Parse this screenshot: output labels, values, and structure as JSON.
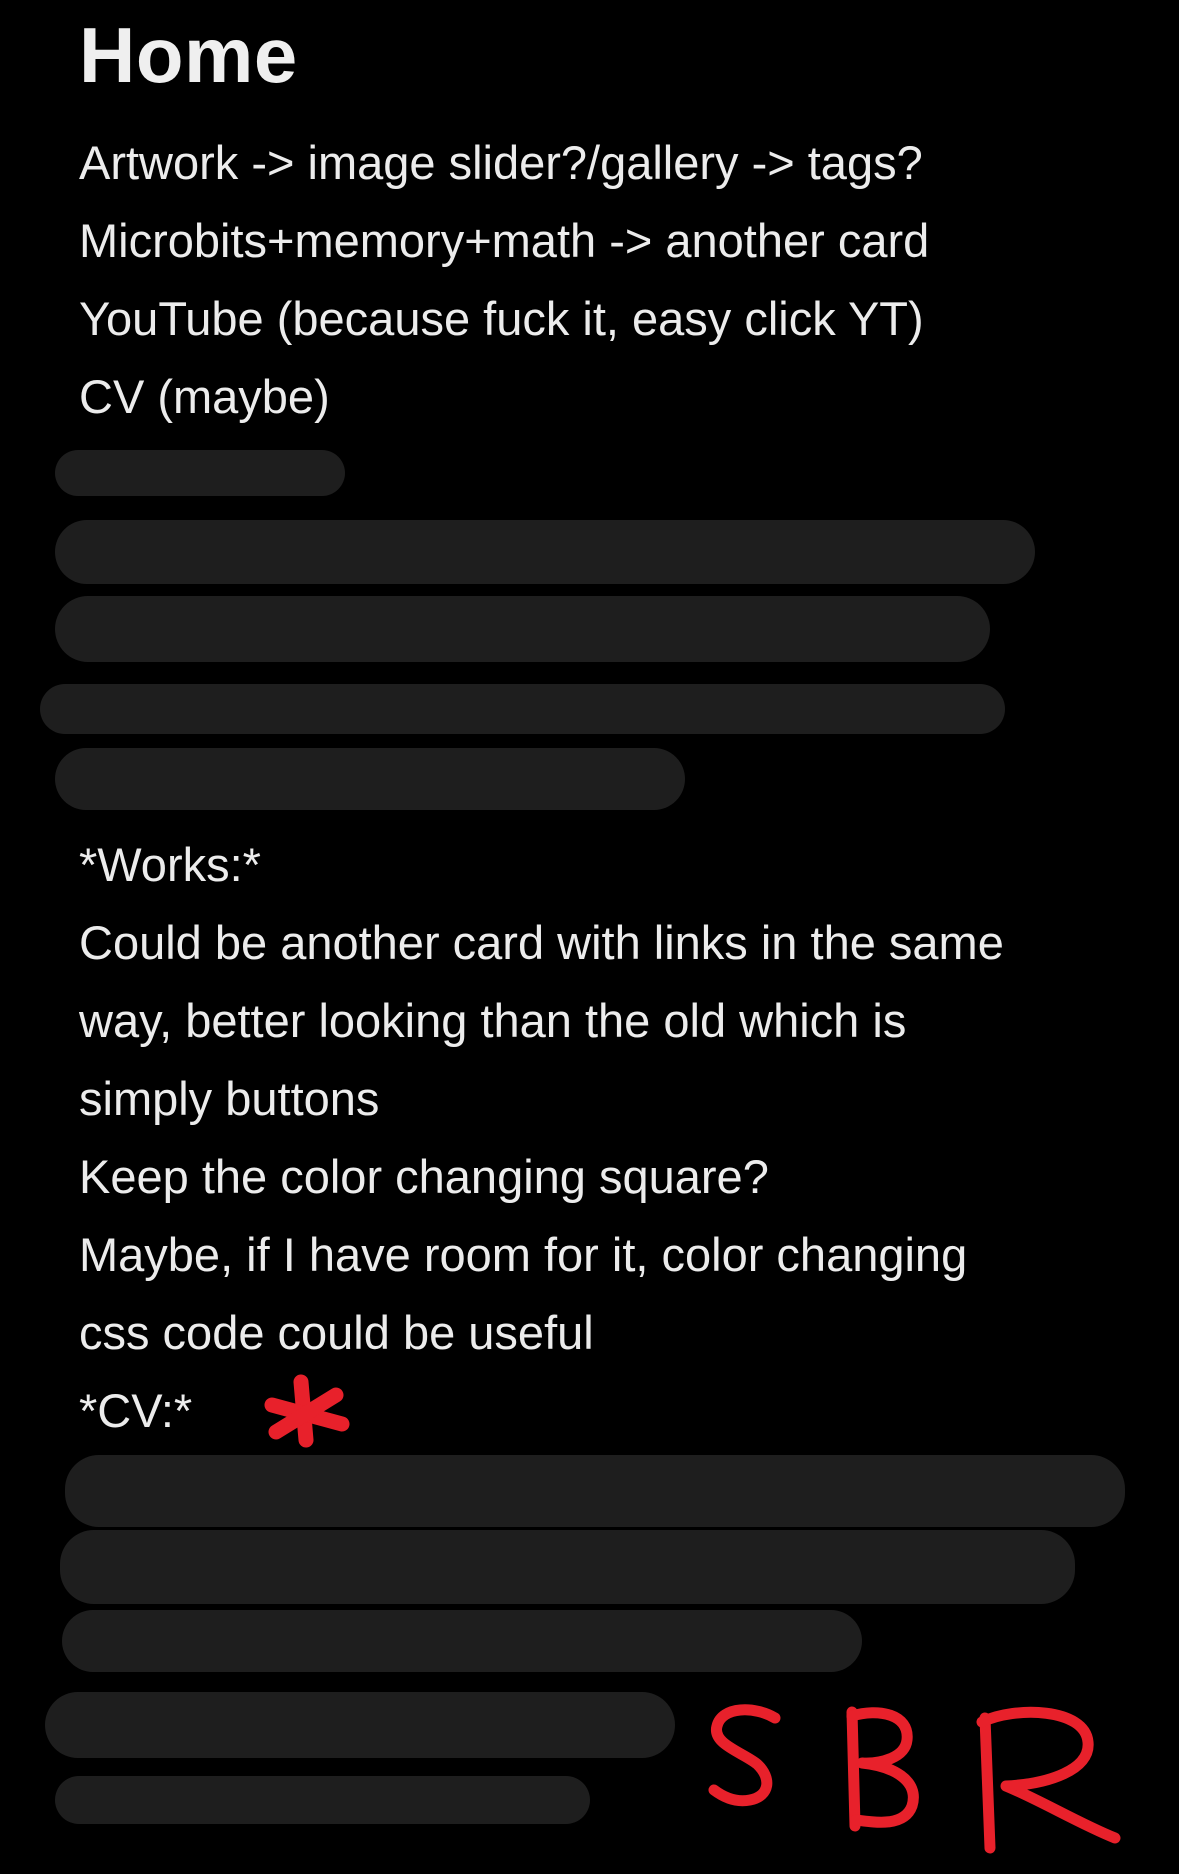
{
  "note": {
    "title": "Home",
    "lines": [
      "Artwork -> image slider?/gallery -> tags?",
      "Microbits+memory+math -> another card",
      "YouTube (because fuck it, easy click YT)",
      "CV (maybe)",
      "*Works:*",
      "Could be another card with links in the same",
      "way, better looking than the old which is",
      "simply buttons",
      "Keep the color changing square?",
      "Maybe, if I have room for it, color changing",
      "css code could be useful",
      "*CV:*"
    ]
  },
  "annotation": {
    "ink_color": "#E8212B",
    "signature_text": "SBR"
  },
  "colors": {
    "background": "#000000",
    "text": "#ECECEC",
    "redaction": "#1E1E1E"
  }
}
